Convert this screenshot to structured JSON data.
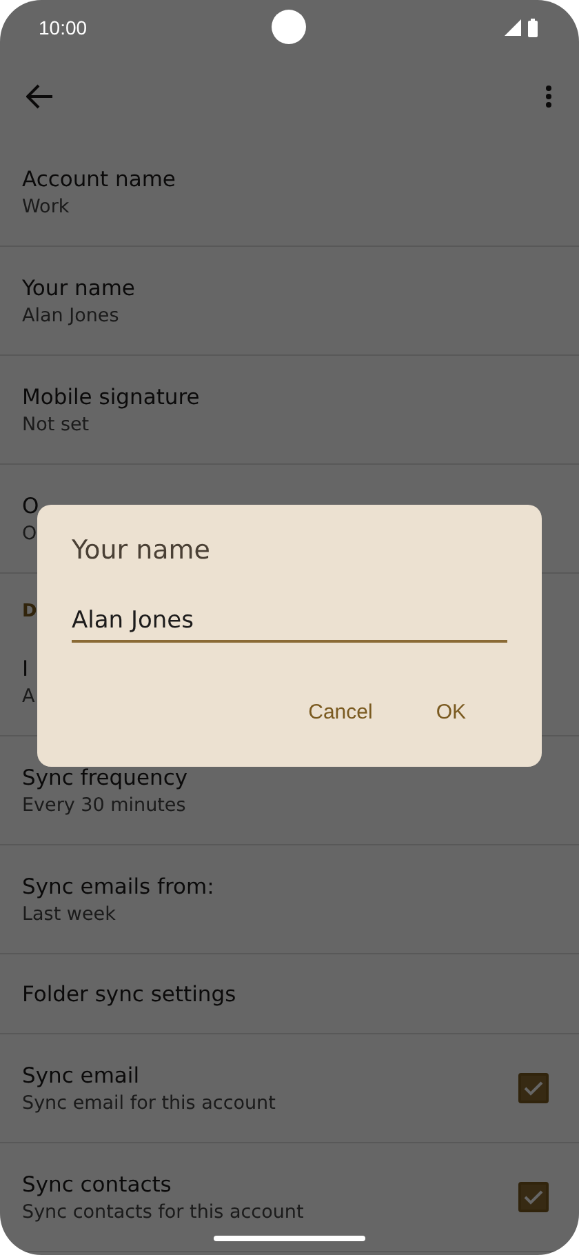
{
  "status_bar": {
    "time": "10:00"
  },
  "settings": [
    {
      "kind": "text",
      "title": "Account name",
      "subtitle": "Work"
    },
    {
      "kind": "text",
      "title": "Your name",
      "subtitle": "Alan Jones"
    },
    {
      "kind": "text",
      "title": "Mobile signature",
      "subtitle": "Not set"
    },
    {
      "kind": "text",
      "title": "O",
      "subtitle": "O"
    },
    {
      "kind": "header",
      "title": "D"
    },
    {
      "kind": "text",
      "title": "I",
      "subtitle": "A"
    },
    {
      "kind": "text",
      "title": "Sync frequency",
      "subtitle": "Every 30 minutes"
    },
    {
      "kind": "text",
      "title": "Sync emails from:",
      "subtitle": "Last week"
    },
    {
      "kind": "text",
      "title": "Folder sync settings"
    },
    {
      "kind": "checkbox",
      "title": "Sync email",
      "subtitle": "Sync email for this account",
      "checked": true
    },
    {
      "kind": "checkbox",
      "title": "Sync contacts",
      "subtitle": "Sync contacts for this account",
      "checked": true
    }
  ],
  "dialog": {
    "title": "Your name",
    "value": "Alan Jones",
    "buttons": [
      "Cancel",
      "OK"
    ]
  }
}
